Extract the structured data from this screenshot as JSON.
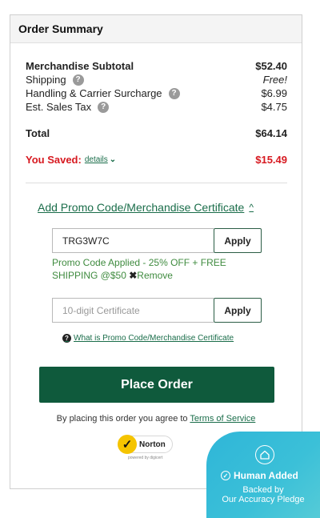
{
  "header": {
    "title": "Order Summary"
  },
  "summary": {
    "subtotal_label": "Merchandise Subtotal",
    "subtotal_value": "$52.40",
    "shipping_label": "Shipping",
    "shipping_value": "Free!",
    "handling_label": "Handling & Carrier Surcharge",
    "handling_value": "$6.99",
    "tax_label": "Est. Sales Tax",
    "tax_value": "$4.75",
    "total_label": "Total",
    "total_value": "$64.14",
    "saved_label": "You Saved:",
    "details_label": "details",
    "saved_value": "$15.49"
  },
  "promo": {
    "toggle_label": "Add Promo Code/Merchandise Certificate",
    "code_value": "TRG3W7C",
    "apply_label": "Apply",
    "applied_message": "Promo Code Applied - 25% OFF + FREE SHIPPING @$50",
    "remove_label": "Remove",
    "certificate_placeholder": "10-digit Certificate",
    "certificate_apply_label": "Apply",
    "what_link": "What is Promo Code/Merchandise Certificate"
  },
  "place_order_label": "Place Order",
  "terms": {
    "prefix": "By placing this order you agree to",
    "link": "Terms of Service"
  },
  "norton": {
    "name": "Norton",
    "sub": "powered by digicert"
  },
  "badge": {
    "title": "Human Added",
    "line1": "Backed by",
    "line2": "Our Accuracy Pledge"
  },
  "colors": {
    "accent_green": "#0f5a3c",
    "link_green": "#1a6d4a",
    "saved_red": "#d71920",
    "badge_blue": "#2fb6d8"
  }
}
